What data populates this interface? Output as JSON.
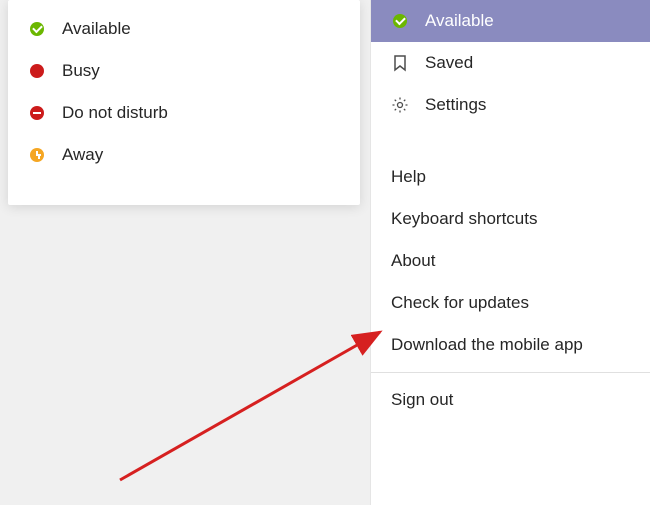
{
  "statusMenu": {
    "items": [
      {
        "label": "Available"
      },
      {
        "label": "Busy"
      },
      {
        "label": "Do not disturb"
      },
      {
        "label": "Away"
      }
    ]
  },
  "mainMenu": {
    "available": "Available",
    "saved": "Saved",
    "settings": "Settings",
    "help": "Help",
    "keyboardShortcuts": "Keyboard shortcuts",
    "about": "About",
    "checkForUpdates": "Check for updates",
    "downloadMobile": "Download the mobile app",
    "signOut": "Sign out"
  }
}
